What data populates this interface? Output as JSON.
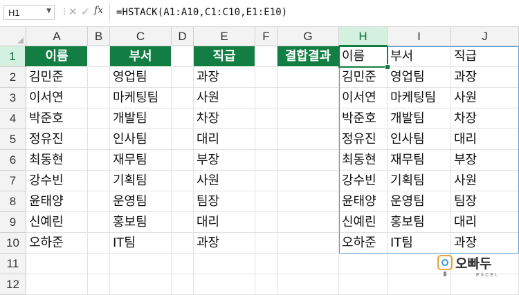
{
  "formula_bar": {
    "name_box": "H1",
    "formula": "=HSTACK(A1:A10,C1:C10,E1:E10)",
    "icons": [
      "more-dots-icon",
      "cancel-x-icon",
      "enter-check-icon",
      "fx-icon"
    ]
  },
  "columns": [
    "A",
    "B",
    "C",
    "D",
    "E",
    "F",
    "G",
    "H",
    "I",
    "J"
  ],
  "rows": [
    "1",
    "2",
    "3",
    "4",
    "5",
    "6",
    "7",
    "8",
    "9",
    "10",
    "11",
    "12"
  ],
  "selected": {
    "column": "H",
    "row": "1"
  },
  "colors": {
    "header_fill": "#137e43",
    "header_text": "#ffffff",
    "selection_accent": "#137e43",
    "spill_border": "#5b9bd5"
  },
  "source": {
    "A": [
      "이름",
      "김민준",
      "이서연",
      "박준호",
      "정유진",
      "최동현",
      "강수빈",
      "윤태양",
      "신예린",
      "오하준"
    ],
    "C": [
      "부서",
      "영업팀",
      "마케팅팀",
      "개발팀",
      "인사팀",
      "재무팀",
      "기획팀",
      "운영팀",
      "홍보팀",
      "IT팀"
    ],
    "E": [
      "직급",
      "과장",
      "사원",
      "차장",
      "대리",
      "부장",
      "사원",
      "팀장",
      "대리",
      "과장"
    ]
  },
  "result_label": "결합결과",
  "result": {
    "H": [
      "이름",
      "김민준",
      "이서연",
      "박준호",
      "정유진",
      "최동현",
      "강수빈",
      "윤태양",
      "신예린",
      "오하준"
    ],
    "I": [
      "부서",
      "영업팀",
      "마케팅팀",
      "개발팀",
      "인사팀",
      "재무팀",
      "기획팀",
      "운영팀",
      "홍보팀",
      "IT팀"
    ],
    "J": [
      "직급",
      "과장",
      "사원",
      "차장",
      "대리",
      "부장",
      "사원",
      "팀장",
      "대리",
      "과장"
    ]
  },
  "logo": {
    "text": "오빠두",
    "sub": "EXCEL"
  }
}
